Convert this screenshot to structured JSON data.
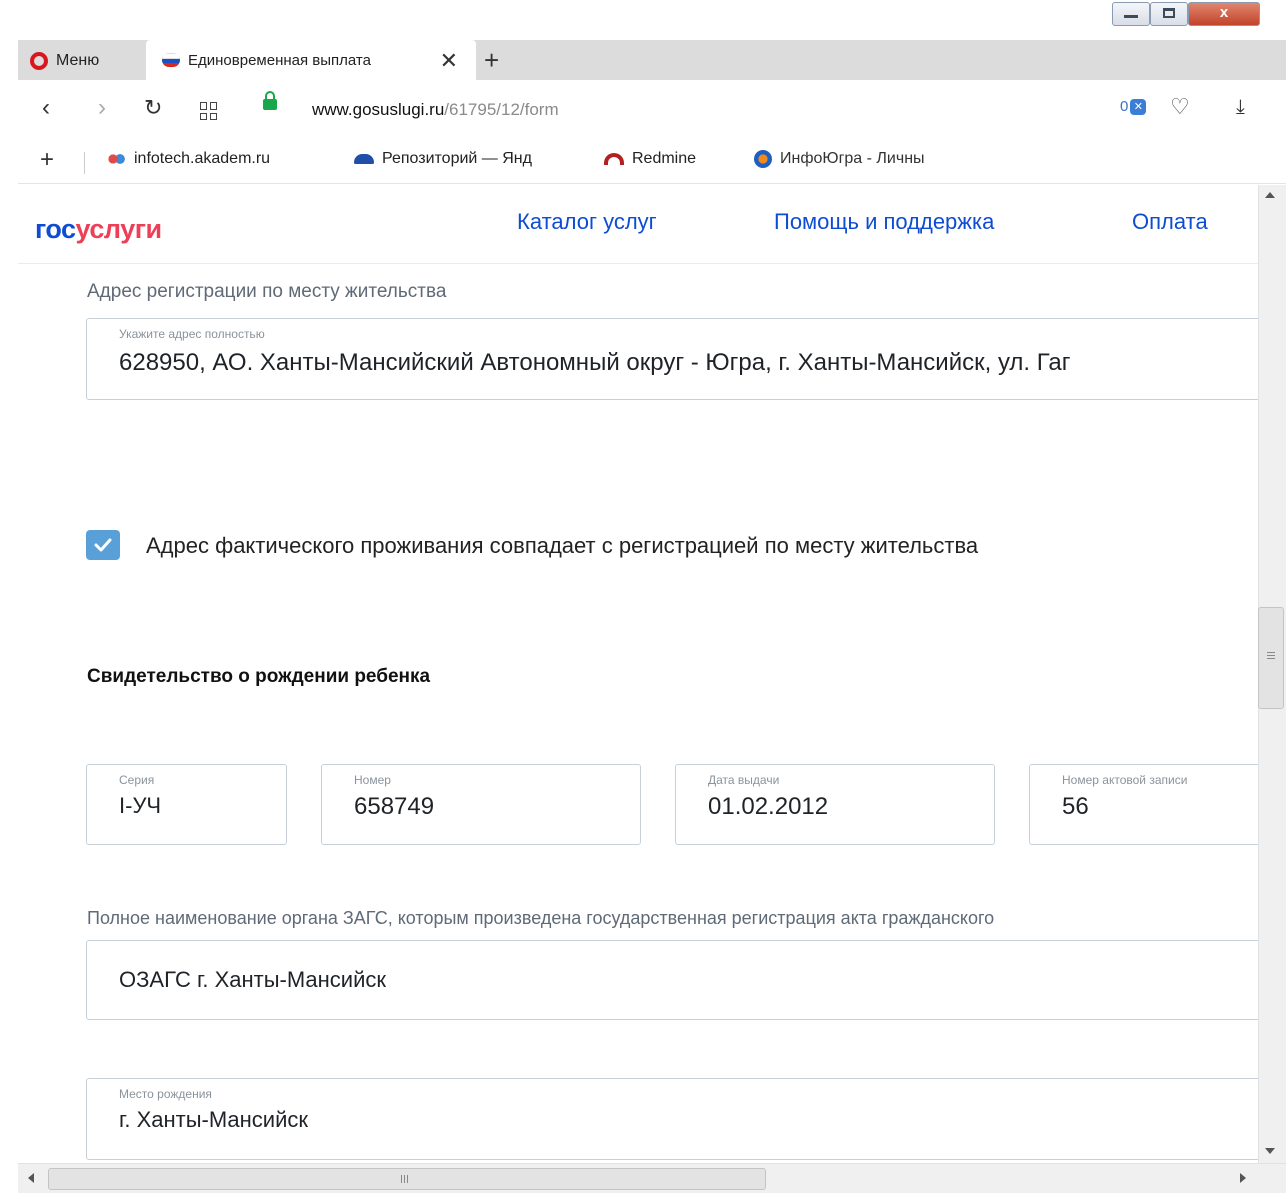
{
  "browser": {
    "menu_label": "Меню",
    "tab_title": "Единовременная выплата",
    "tab_close": "✕",
    "new_tab": "+",
    "url_host": "www.gosuslugi.ru",
    "url_path": "/61795/12/form",
    "adblock_count": "0",
    "bookmarks": [
      "infotech.akadem.ru",
      "Репозиторий — Янд",
      "Redmine",
      "ИнфоЮгра - Личны"
    ],
    "window_close": "x"
  },
  "header": {
    "logo_part1": "гос",
    "logo_part2": "услуги",
    "nav": [
      "Каталог услуг",
      "Помощь и поддержка",
      "Оплата"
    ]
  },
  "form": {
    "reg_address_label": "Адрес регистрации по месту жительства",
    "reg_address_placeholder": "Укажите адрес полностью",
    "reg_address_value": "628950, АО. Ханты-Мансийский Автономный округ - Югра, г. Ханты-Мансийск, ул. Гаг",
    "same_address_checked": true,
    "same_address_label": "Адрес фактического проживания совпадает с регистрацией по месту жительства",
    "section_title": "Свидетельство о рождении ребенка",
    "certificate": {
      "series_label": "Серия",
      "series_value": "I-УЧ",
      "number_label": "Номер",
      "number_value": "658749",
      "date_label": "Дата выдачи",
      "date_value": "01.02.2012",
      "record_label": "Номер актовой записи",
      "record_value": "56"
    },
    "zags_label": "Полное наименование органа ЗАГС, которым произведена государственная регистрация акта гражданского",
    "zags_value": "ОЗАГС г. Ханты-Мансийск",
    "birthplace_label": "Место рождения",
    "birthplace_value": "г. Ханты-Мансийск"
  },
  "colors": {
    "brand_blue": "#0d4cd3",
    "brand_red": "#ee3f58",
    "checkbox_blue": "#5aa0d8"
  }
}
